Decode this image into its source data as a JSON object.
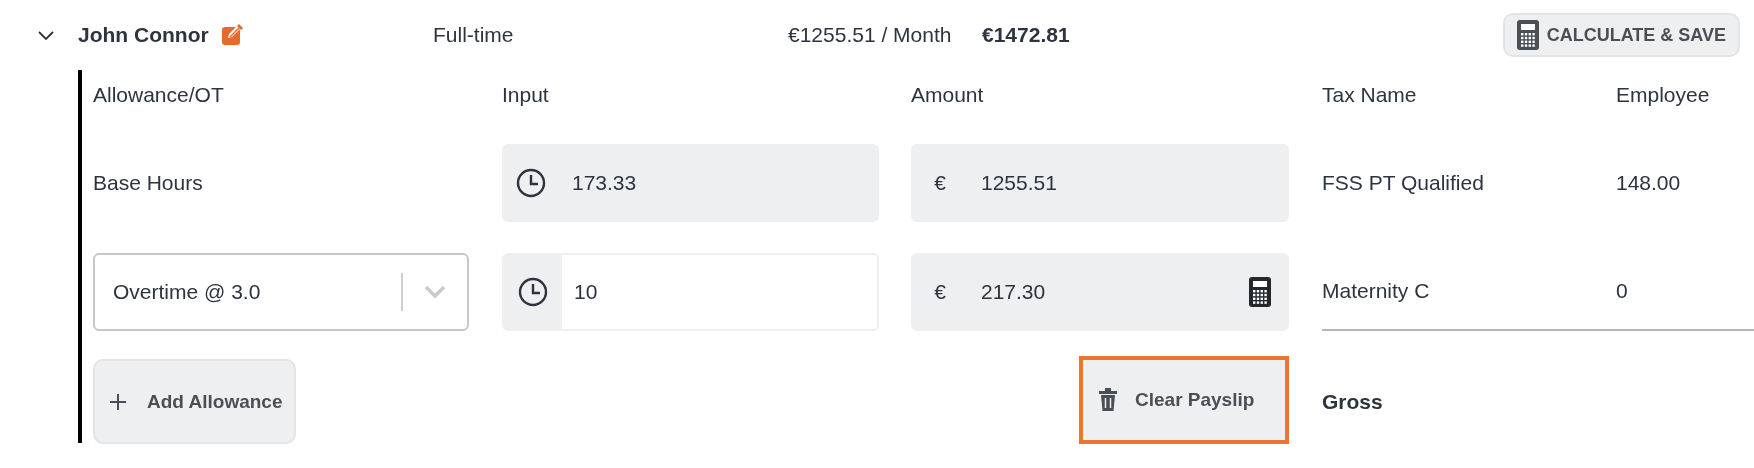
{
  "employee": {
    "name": "John Connor",
    "expanded": true,
    "employment_type": "Full-time",
    "base_pay": "€1255.51 / Month",
    "total": "€1472.81"
  },
  "save_button": "CALCULATE & SAVE",
  "columns": {
    "allowance": "Allowance/OT",
    "input": "Input",
    "amount": "Amount",
    "tax_name": "Tax Name",
    "employee": "Employee"
  },
  "rows": [
    {
      "kind": "fixed",
      "label": "Base Hours",
      "input": "173.33",
      "currency": "€",
      "amount": "1255.51",
      "tax_name": "FSS PT Qualified",
      "tax_employee": "148.00"
    },
    {
      "kind": "select",
      "label": "Overtime @ 3.0",
      "input": "10",
      "currency": "€",
      "amount": "217.30",
      "tax_name": "Maternity C",
      "tax_employee": "0"
    }
  ],
  "add_button": "Add Allowance",
  "clear_button": "Clear Payslip",
  "gross_label": "Gross"
}
